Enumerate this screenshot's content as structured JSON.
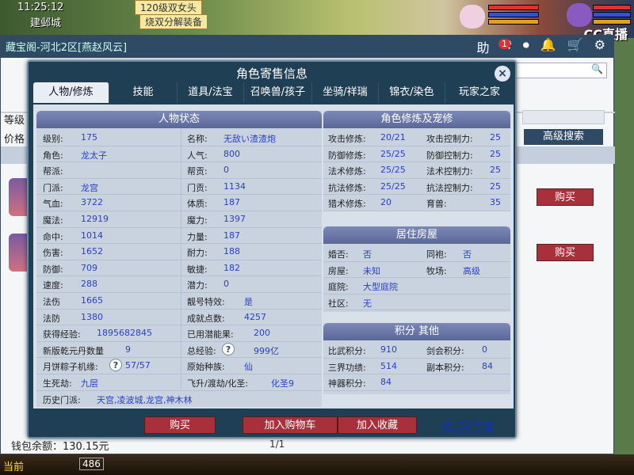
{
  "game": {
    "time": "11:25:12",
    "city": "建邺城",
    "banner_top": "120级双女头",
    "banner_sub": "烧双分解装备",
    "cc_logo": "CC直播",
    "bottom_left": "当前",
    "bottom_num": "486"
  },
  "bg_window": {
    "title": "藏宝阁-河北2区[燕赵风云]",
    "toolbar_icons": [
      "助",
      "gavel-icon",
      "stop-icon",
      "bell-icon",
      "cart-icon",
      "settings-icon"
    ],
    "notification_count": "1",
    "left_label_level": "等级",
    "left_label_price": "价格",
    "adv_search": "高级搜索",
    "buy_label": "购买",
    "wallet": "钱包余额：130.15元",
    "pager": "1/1"
  },
  "modal": {
    "title": "角色寄售信息",
    "close": "×",
    "tabs": [
      "人物/修炼",
      "技能",
      "道具/法宝",
      "召唤兽/孩子",
      "坐骑/祥瑞",
      "锦衣/染色",
      "玩家之家"
    ],
    "active_tab": 0,
    "status": {
      "heading": "人物状态",
      "rows": [
        {
          "l1": "级别:",
          "v1": "175",
          "l2": "名称:",
          "v2": "无敌い渣渣炮"
        },
        {
          "l1": "角色:",
          "v1": "龙太子",
          "l2": "人气:",
          "v2": "800"
        },
        {
          "l1": "帮派:",
          "v1": "",
          "l2": "帮贡:",
          "v2": "0"
        },
        {
          "l1": "门派:",
          "v1": "龙宫",
          "l2": "门贡:",
          "v2": "1134"
        },
        {
          "l1": "气血:",
          "v1": "3722",
          "l2": "体质:",
          "v2": "187"
        },
        {
          "l1": "魔法:",
          "v1": "12919",
          "l2": "魔力:",
          "v2": "1397"
        },
        {
          "l1": "命中:",
          "v1": "1014",
          "l2": "力量:",
          "v2": "187"
        },
        {
          "l1": "伤害:",
          "v1": "1652",
          "l2": "耐力:",
          "v2": "188"
        },
        {
          "l1": "防御:",
          "v1": "709",
          "l2": "敏捷:",
          "v2": "182"
        },
        {
          "l1": "速度:",
          "v1": "288",
          "l2": "潜力:",
          "v2": "0"
        },
        {
          "l1": "法伤",
          "v1": "1665",
          "l2": "靓号特效:",
          "v2": "是"
        },
        {
          "l1": "法防",
          "v1": "1380",
          "l2": "成就点数:",
          "v2": "4257"
        },
        {
          "l1": "获得经验:",
          "v1": "1895682845",
          "l2": "已用潜能果:",
          "v2": "200"
        },
        {
          "l1": "新版乾元丹数量",
          "v1": "9",
          "l2": "总经验:",
          "v2": "999亿"
        },
        {
          "l1": "月饼粽子机缘:",
          "v1": "57/57",
          "l2": "原始种族:",
          "v2": "仙"
        },
        {
          "l1": "生死劫:",
          "v1": "九层",
          "l2": "飞升/渡劫/化圣:",
          "v2": "化圣9"
        }
      ],
      "history_label": "历史门派:",
      "history_value": "天宫,凌波城,龙宫,神木林"
    },
    "cultivation": {
      "heading": "角色修炼及宠修",
      "rows": [
        {
          "l1": "攻击修炼:",
          "v1": "20/21",
          "l2": "攻击控制力:",
          "v2": "25"
        },
        {
          "l1": "防御修炼:",
          "v1": "25/25",
          "l2": "防御控制力:",
          "v2": "25"
        },
        {
          "l1": "法术修炼:",
          "v1": "25/25",
          "l2": "法术控制力:",
          "v2": "25"
        },
        {
          "l1": "抗法修炼:",
          "v1": "25/25",
          "l2": "抗法控制力:",
          "v2": "25"
        },
        {
          "l1": "猎术修炼:",
          "v1": "20",
          "l2": "育兽:",
          "v2": "35"
        }
      ]
    },
    "residence": {
      "heading": "居住房屋",
      "rows": [
        {
          "l1": "婚否:",
          "v1": "否",
          "l2": "同袍:",
          "v2": "否"
        },
        {
          "l1": "房屋:",
          "v1": "未知",
          "l2": "牧场:",
          "v2": "高级"
        },
        {
          "l1": "庭院:",
          "v1": "大型庭院",
          "l2": "",
          "v2": ""
        },
        {
          "l1": "社区:",
          "v1": "无",
          "l2": "",
          "v2": ""
        }
      ]
    },
    "points": {
      "heading": "积分 其他",
      "rows": [
        {
          "l1": "比武积分:",
          "v1": "910",
          "l2": "剑会积分:",
          "v2": "0"
        },
        {
          "l1": "三界功绩:",
          "v1": "514",
          "l2": "副本积分:",
          "v2": "84"
        },
        {
          "l1": "神器积分:",
          "v1": "84",
          "l2": "",
          "v2": ""
        }
      ]
    },
    "footer": {
      "buy": "购买",
      "add_cart": "加入购物车",
      "add_fav": "加入收藏",
      "web_link": "使用网页版"
    }
  }
}
